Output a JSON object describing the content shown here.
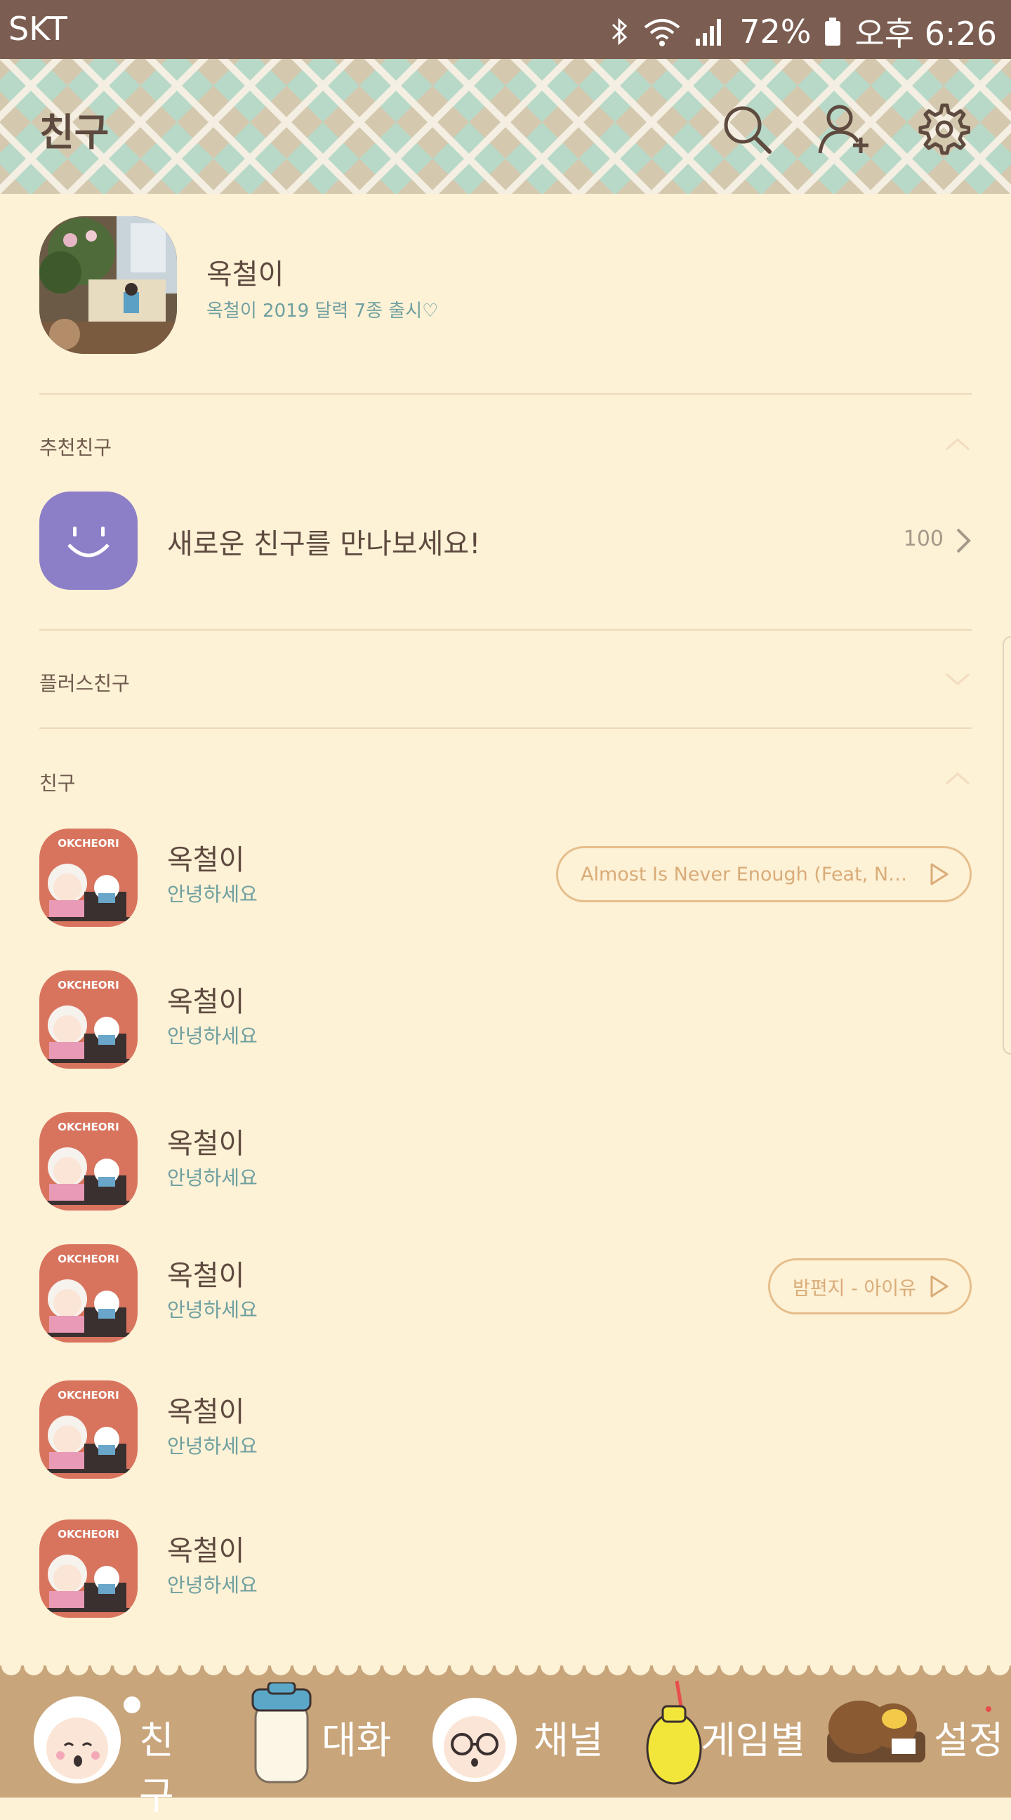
{
  "status_bar": {
    "carrier": "SKT",
    "battery": "72%",
    "time": "오후 6:26"
  },
  "header": {
    "title": "친구"
  },
  "profile": {
    "name": "옥철이",
    "status": "옥철이 2019 달력 7종 출시♡"
  },
  "recommended": {
    "section": "추천친구",
    "label": "새로운 친구를 만나보세요!",
    "count": "100"
  },
  "plus_friends": {
    "section": "플러스친구"
  },
  "friends": {
    "section": "친구",
    "items": [
      {
        "name": "옥철이",
        "status": "안녕하세요",
        "music": "Almost Is Never Enough (Feat, Natha···"
      },
      {
        "name": "옥철이",
        "status": "안녕하세요",
        "music": ""
      },
      {
        "name": "옥철이",
        "status": "안녕하세요",
        "music": ""
      },
      {
        "name": "옥철이",
        "status": "안녕하세요",
        "music": "밤편지 - 아이유"
      },
      {
        "name": "옥철이",
        "status": "안녕하세요",
        "music": ""
      },
      {
        "name": "옥철이",
        "status": "안녕하세요",
        "music": ""
      }
    ]
  },
  "tabs": [
    {
      "label": "친구",
      "icon": "friends-character-icon"
    },
    {
      "label": "대화",
      "icon": "chat-jar-icon"
    },
    {
      "label": "채널",
      "icon": "channel-character-icon"
    },
    {
      "label": "게임별",
      "icon": "game-bottle-icon"
    },
    {
      "label": "설정",
      "icon": "settings-bread-icon"
    }
  ],
  "avatar_badge_text": "OKCHEORI",
  "colors": {
    "status_bar": "#7b5e51",
    "background": "#fdf1d6",
    "tab_bar": "#c8a57a",
    "accent_text": "#6fa0a0",
    "music_pill": "#e6be8b",
    "recommend_avatar": "#8c7fc7"
  }
}
